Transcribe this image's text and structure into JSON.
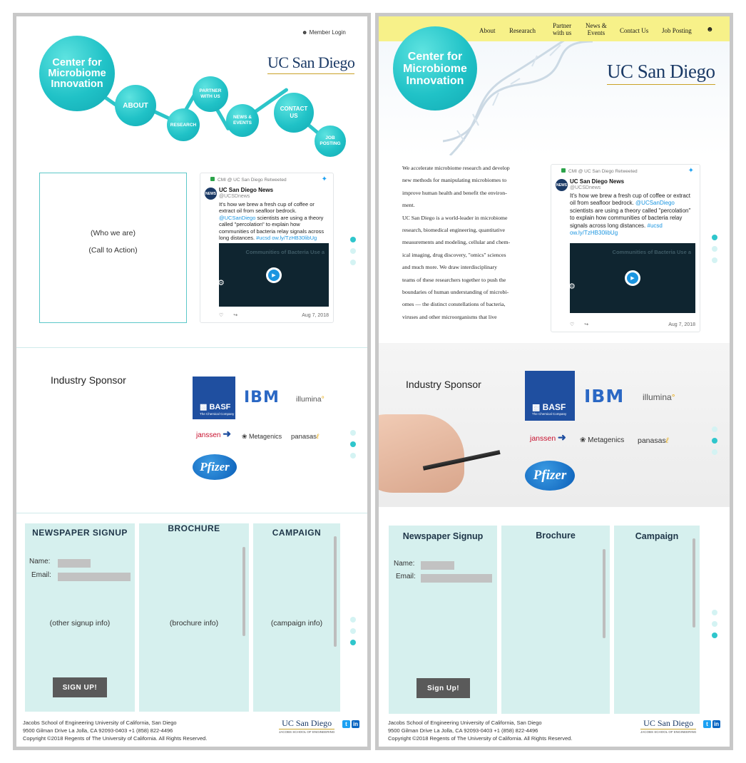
{
  "brand": {
    "center_line1": "Center for",
    "center_line2": "Microbiome",
    "center_line3": "Innovation",
    "university": "UC San Diego"
  },
  "left_mockup": {
    "member_login": "Member Login",
    "bubbles": {
      "about": "ABOUT",
      "research": "RESEARCH",
      "partner1": "PARTNER",
      "partner2": "WITH US",
      "news1": "NEWS &",
      "news2": "EVENTS",
      "contact1": "CONTACT",
      "contact2": "US",
      "job1": "JOB",
      "job2": "POSTING"
    },
    "who_we_are": "(Who we are)",
    "call_to_action": "(Call to Action)",
    "sponsor_title": "Industry Sponsor",
    "cards": {
      "signup_title": "NEWSPAPER SIGNUP",
      "brochure_title": "BROCHURE",
      "campaign_title": "CAMPAIGN",
      "name_label": "Name:",
      "email_label": "Email:",
      "signup_info": "(other signup info)",
      "brochure_info": "(brochure info)",
      "campaign_info": "(campaign info)",
      "signup_button": "SIGN UP!"
    }
  },
  "right_mockup": {
    "nav": {
      "about": "About",
      "research": "Researach",
      "partner1": "Partner",
      "partner2": "with us",
      "news1": "News &",
      "news2": "Events",
      "contact": "Contact Us",
      "jobs": "Job Posting"
    },
    "intro": [
      "We accelerate microbiome research and develop",
      "new methods for manipulating microbiomes to",
      "improve human health and benefit the environ-",
      "ment.",
      "UC San Diego is a world-leader in microbiome",
      "research, biomedical engineering, quantitative",
      "measurements and modeling, cellular and chem-",
      "ical imaging, drug discovery, \"omics\" sciences",
      "and much more. We draw interdisciplinary",
      "teams of these researchers together to push the",
      "boundaries of human understanding of microbi-",
      "omes — the distinct constellations of bacteria,",
      "viruses and other microorganisms that live"
    ],
    "sponsor_title": "Industry Sponsor",
    "cards": {
      "signup_title": "Newspaper Signup",
      "brochure_title": "Brochure",
      "campaign_title": "Campaign",
      "name_label": "Name:",
      "email_label": "Email:",
      "signup_button": "Sign Up!"
    }
  },
  "tweet": {
    "retweeted": "CMI @ UC San Diego Retweeted",
    "avatar": "NEWS",
    "name": "UC San Diego News",
    "handle": "@UCSDnews",
    "text1": "It's how we brew a fresh cup of coffee or extract oil from seafloor bedrock. ",
    "mention": "@UCSanDiego",
    "text2": " scientists are using a theory called \"percolation\" to explain how communities of bacteria relay signals across long distances. ",
    "hashtag": "#ucsd",
    "link": "ow.ly/TzHB30libUg",
    "video_caption": "Communities of Bacteria Use a",
    "date": "Aug 7, 2018"
  },
  "sponsors": {
    "basf": "BASF",
    "basf_sub": "The Chemical Company",
    "ibm": "IBM",
    "illumina": "illumina",
    "janssen": "janssen",
    "metagenics": "Metagenics",
    "panasas": "panasas",
    "pfizer": "Pfizer"
  },
  "footer": {
    "line1": "Jacobs School of Engineering   University of California, San Diego",
    "line2": "9500 Gilman Drive   La Jolla, CA 92093-0403   +1 (858) 822-4496",
    "line3": "Copyright ©2018 Regents of The University of California. All Rights Reserved.",
    "logo": "UC San Diego",
    "logo_sub": "JACOBS SCHOOL OF ENGINEERING",
    "twitter": "t",
    "linkedin": "in"
  },
  "colors": {
    "teal": "#20c2c7",
    "navbar_yellow": "#f7f189",
    "card_bg": "#d6f0ee",
    "ucsd_navy": "#1b3a66"
  },
  "icons": [
    "user-icon",
    "twitter-bird-icon",
    "retweet-icon",
    "play-icon",
    "heart-icon",
    "share-icon",
    "twitter-icon",
    "linkedin-icon"
  ]
}
